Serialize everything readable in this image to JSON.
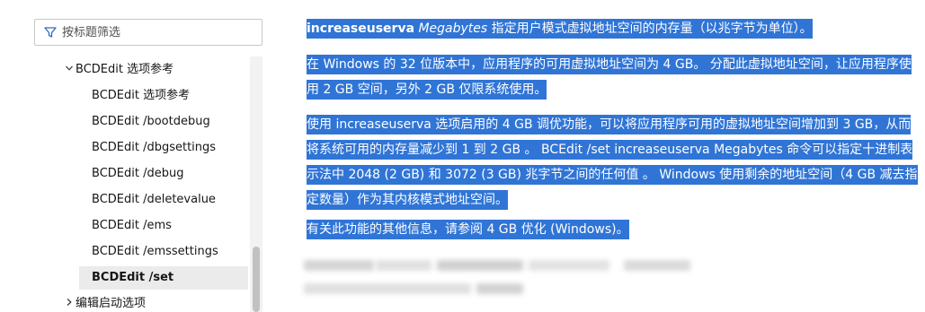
{
  "sidebar": {
    "filter_placeholder": "按标题筛选",
    "parent": {
      "label": "BCDEdit 选项参考"
    },
    "items": [
      {
        "label": "BCDEdit 选项参考"
      },
      {
        "label": "BCDEdit /bootdebug"
      },
      {
        "label": "BCDEdit /dbgsettings"
      },
      {
        "label": "BCDEdit /debug"
      },
      {
        "label": "BCDEdit /deletevalue"
      },
      {
        "label": "BCDEdit /ems"
      },
      {
        "label": "BCDEdit /emssettings"
      },
      {
        "label": "BCDEdit /set"
      }
    ],
    "next_section": {
      "label": "编辑启动选项"
    }
  },
  "content": {
    "p1": {
      "option": "increaseuserva",
      "param": "Megabytes",
      "rest": " 指定用户模式虚拟地址空间的内存量（以兆字节为单位）。"
    },
    "p2": "在 Windows 的 32 位版本中，应用程序的可用虚拟地址空间为 4 GB。 分配此虚拟地址空间，让应用程序使用 2 GB 空间，另外 2 GB 仅限系统使用。",
    "p3": "使用 increaseuserva 选项启用的 4 GB 调优功能，可以将应用程序可用的虚拟地址空间增加到 3 GB，从而将系统可用的内存量减少到 1 到 2 GB 。 BCEdit /set increaseuserva Megabytes 命令可以指定十进制表示法中 2048 (2 GB) 和 3072 (3 GB) 兆字节之间的任何值 。 Windows 使用剩余的地址空间（4 GB 减去指定数量）作为其内核模式地址空间。",
    "p4": "有关此功能的其他信息，请参阅 4 GB 优化 (Windows)。"
  },
  "colors": {
    "selection": "#3075d6",
    "active_item_bg": "#ebebeb"
  },
  "icons": {
    "filter": "filter-icon",
    "expanded": "chevron-down-icon",
    "collapsed": "chevron-right-icon"
  }
}
